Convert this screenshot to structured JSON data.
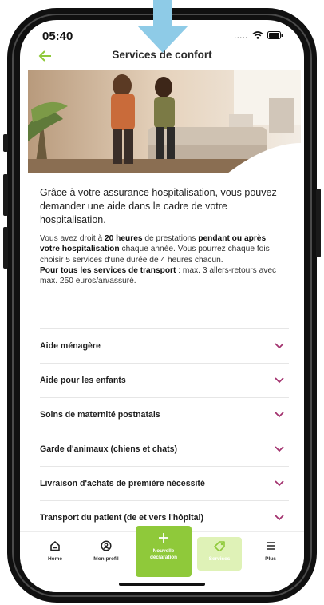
{
  "status_bar": {
    "time": "05:40",
    "signal": "....."
  },
  "header": {
    "title": "Services de confort"
  },
  "intro": "Grâce à votre assurance hospitalisation, vous pouvez demander une aide dans le cadre de votre hospitalisation.",
  "details": {
    "p1_a": "Vous avez droit à ",
    "p1_b": "20 heures",
    "p1_c": " de prestations ",
    "p1_d": "pendant ou après votre hospitalisation",
    "p1_e": " chaque année. Vous pourrez chaque fois choisir 5 services d'une durée de 4 heures chacun.",
    "p2_a": "Pour tous les services de transport",
    "p2_b": " : max. 3 allers-retours avec max. 250 euros/an/assuré."
  },
  "accordion": [
    {
      "label": "Aide ménagère"
    },
    {
      "label": "Aide pour les enfants"
    },
    {
      "label": "Soins de maternité postnatals"
    },
    {
      "label": "Garde d'animaux (chiens et chats)"
    },
    {
      "label": "Livraison d'achats de première nécessité"
    },
    {
      "label": "Transport du patient (de et vers l'hôpital)"
    }
  ],
  "nav": {
    "home": "Home",
    "profile": "Mon profil",
    "cta_line1": "Nouvelle",
    "cta_line2": "déclaration",
    "services": "Services",
    "more": "Plus"
  },
  "colors": {
    "accent": "#8fc93a",
    "chevron": "#a3336f",
    "pointer": "#8ecbe7",
    "services_bg": "#dff2b7"
  }
}
